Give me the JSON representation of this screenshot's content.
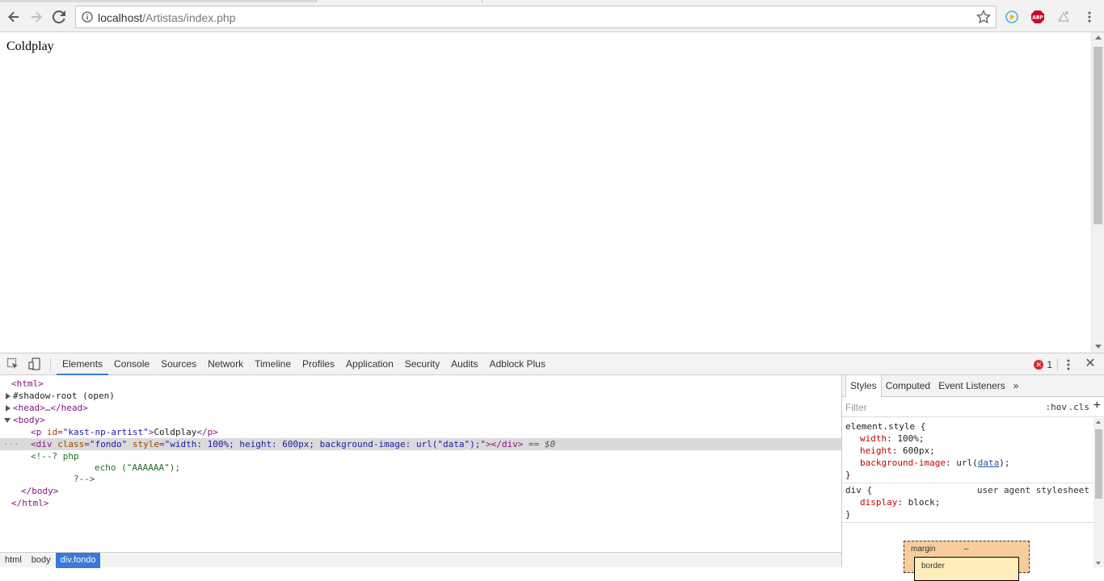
{
  "browser": {
    "url_host": "localhost",
    "url_path": "/Artistas/index.php"
  },
  "page": {
    "text": "Coldplay"
  },
  "devtools": {
    "tabs": [
      "Elements",
      "Console",
      "Sources",
      "Network",
      "Timeline",
      "Profiles",
      "Application",
      "Security",
      "Audits",
      "Adblock Plus"
    ],
    "active_tab": "Elements",
    "error_count": "1",
    "dom": {
      "html_open": "<html>",
      "shadow_root": "#shadow-root (open)",
      "head": "<head>…</head>",
      "body_open": "<body>",
      "p_tag_open": "<p",
      "p_attr_name": "id",
      "p_attr_value": "\"kast-np-artist\"",
      "p_text": "Coldplay",
      "p_close": "</p>",
      "div_tag_open": "<div",
      "div_class_name": "class",
      "div_class_value": "\"fondo\"",
      "div_style_name": "style",
      "div_style_value": "\"width: 100%; height: 600px; background-image: url(\"data\");\"",
      "div_close": "></div>",
      "selected_marker": "== $0",
      "comment_1": "<!--? php",
      "comment_2": "echo (\"AAAAAA\");",
      "comment_3": "?-->",
      "body_close": "</body>",
      "html_close": "</html>"
    },
    "breadcrumb": [
      "html",
      "body",
      "div.fondo"
    ],
    "sidebar": {
      "tabs": [
        "Styles",
        "Computed",
        "Event Listeners"
      ],
      "more": "»",
      "filter_placeholder": "Filter",
      "hov": ":hov",
      "cls": ".cls",
      "plus": "+",
      "element_style_selector": "element.style {",
      "element_style_props": [
        {
          "name": "width",
          "value": "100%;"
        },
        {
          "name": "height",
          "value": "600px;"
        }
      ],
      "bg_prop_name": "background-image",
      "bg_value_prefix": "url(",
      "bg_value_link": "data",
      "bg_value_suffix": ");",
      "close_brace": "}",
      "div_selector": "div {",
      "ua_label": "user agent stylesheet",
      "div_props": [
        {
          "name": "display",
          "value": "block;"
        }
      ],
      "boxmodel_margin": "margin",
      "boxmodel_margin_value": "–",
      "boxmodel_border": "border"
    }
  }
}
